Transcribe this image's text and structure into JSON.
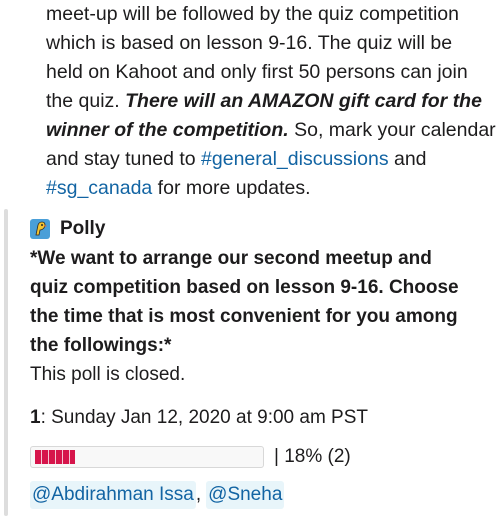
{
  "message": {
    "line1": "meet-up will be followed by the quiz competition",
    "line2": "which is based on lesson 9-16. The quiz will be",
    "line3": "held on Kahoot and only first 50 persons can join",
    "line4_pre": "the quiz. ",
    "line4_bi": "There will an AMAZON gift card for the",
    "line5_bi": "winner of the competition.",
    "line5_post": " So, mark your calendar",
    "line6_pre": "and stay tuned to ",
    "line6_link": "#general_discussions",
    "line6_post": " and",
    "line7_link": "#sg_canada",
    "line7_post": " for more updates."
  },
  "poll": {
    "author": "Polly",
    "question_line1": "*We want to arrange our second meetup and",
    "question_line2": "quiz competition based on lesson 9-16.  Choose",
    "question_line3": "the time that is most convenient for you among",
    "question_line4": "the followings:*",
    "status": "This poll is closed.",
    "options": [
      {
        "number": "1",
        "label": ": Sunday Jan 12, 2020 at 9:00 am PST",
        "result_text": "| 18% (2)",
        "percent": 18,
        "voters": [
          "@Abdirahman Issa",
          "@Sneha"
        ],
        "voter_separator": ","
      }
    ]
  },
  "colors": {
    "link": "#1264a3",
    "bar": "#d6154b",
    "mention_bg": "#e8f5fa"
  },
  "icons": {
    "app_icon": "polly-parrot-icon"
  }
}
